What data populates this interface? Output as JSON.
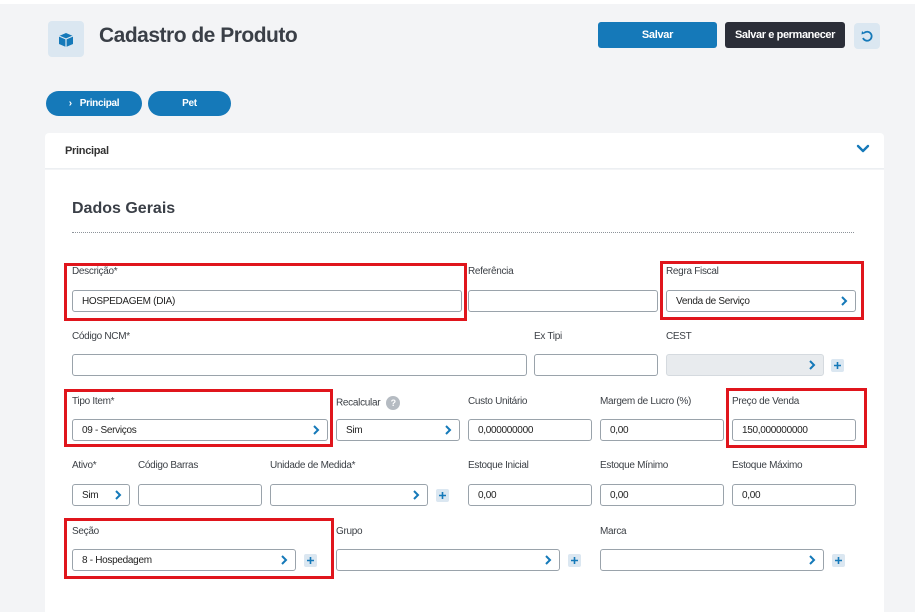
{
  "header": {
    "title": "Cadastro de Produto",
    "save_label": "Salvar",
    "save_stay_label": "Salvar e permanecer"
  },
  "tabs": [
    {
      "label": "Principal",
      "active": true
    },
    {
      "label": "Pet",
      "active": false
    }
  ],
  "panel": {
    "label": "Principal",
    "section_title": "Dados Gerais"
  },
  "fields": {
    "descricao": {
      "label": "Descrição*",
      "value": "HOSPEDAGEM (DIA)"
    },
    "referencia": {
      "label": "Referência",
      "value": ""
    },
    "regra_fiscal": {
      "label": "Regra Fiscal",
      "value": "Venda de Serviço"
    },
    "codigo_ncm": {
      "label": "Código NCM*",
      "value": ""
    },
    "ex_tipi": {
      "label": "Ex Tipi",
      "value": ""
    },
    "cest": {
      "label": "CEST",
      "value": ""
    },
    "tipo_item": {
      "label": "Tipo Item*",
      "value": "09 - Serviços"
    },
    "recalcular": {
      "label": "Recalcular",
      "value": "Sim",
      "help": "?"
    },
    "custo_unitario": {
      "label": "Custo Unitário",
      "value": "0,000000000"
    },
    "margem_lucro": {
      "label": "Margem de Lucro (%)",
      "value": "0,00"
    },
    "preco_venda": {
      "label": "Preço de Venda",
      "value": "150,000000000"
    },
    "ativo": {
      "label": "Ativo*",
      "value": "Sim"
    },
    "codigo_barras": {
      "label": "Código Barras",
      "value": ""
    },
    "unidade_medida": {
      "label": "Unidade de Medida*",
      "value": ""
    },
    "estoque_inicial": {
      "label": "Estoque Inicial",
      "value": "0,00"
    },
    "estoque_minimo": {
      "label": "Estoque Mínimo",
      "value": "0,00"
    },
    "estoque_maximo": {
      "label": "Estoque Máximo",
      "value": "0,00"
    },
    "secao": {
      "label": "Seção",
      "value": "8 - Hospedagem"
    },
    "grupo": {
      "label": "Grupo",
      "value": ""
    },
    "marca": {
      "label": "Marca",
      "value": ""
    }
  },
  "colors": {
    "primary": "#1579b9",
    "dark_button": "#2b2e38",
    "highlight": "#e0151c"
  }
}
